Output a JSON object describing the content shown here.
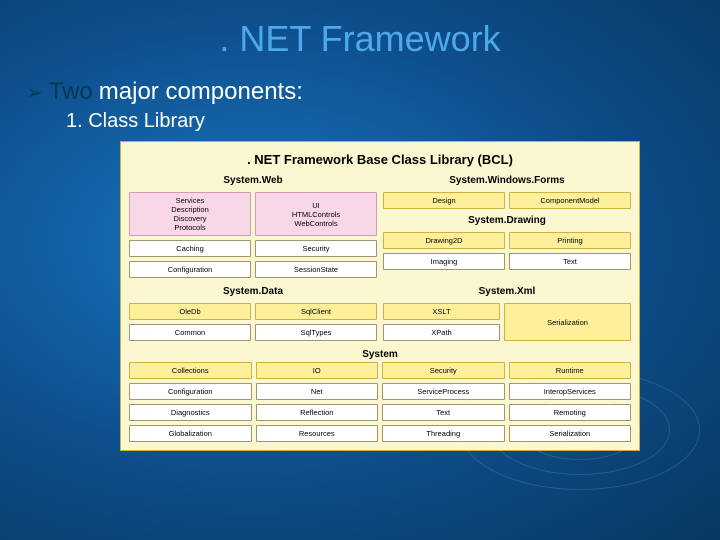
{
  "title": ". NET Framework",
  "bullet": {
    "arrow": "➢",
    "lead": "Two",
    "rest": " major components:"
  },
  "sub": "1. Class Library",
  "diagram": {
    "title": ". NET Framework Base Class Library (BCL)",
    "web": {
      "title": "System.Web",
      "row1": [
        {
          "lines": [
            "Services",
            "Description",
            "Discovery",
            "Protocols"
          ]
        },
        {
          "lines": [
            "UI",
            "HTMLControls",
            "WebControls"
          ]
        }
      ],
      "row2": [
        "Caching",
        "Security"
      ],
      "row3": [
        "Configuration",
        "SessionState"
      ]
    },
    "forms": {
      "title": "System.Windows.Forms",
      "row1": [
        "Design",
        "ComponentModel"
      ]
    },
    "drawing": {
      "title": "System.Drawing",
      "row1": [
        "Drawing2D",
        "Printing"
      ],
      "row2": [
        "Imaging",
        "Text"
      ]
    },
    "data": {
      "title": "System.Data",
      "row1": [
        "OleDb",
        "SqlClient"
      ],
      "row2": [
        "Common",
        "SqlTypes"
      ]
    },
    "xml": {
      "title": "System.Xml",
      "side": "Serialization",
      "col": [
        "XSLT",
        "XPath"
      ]
    },
    "system": {
      "title": "System",
      "row1": [
        "Collections",
        "IO",
        "Security",
        "Runtime"
      ],
      "row2": [
        "Configuration",
        "Net",
        "ServiceProcess",
        "InteropServices"
      ],
      "row3": [
        "Diagnostics",
        "Reflection",
        "Text",
        "Remoting"
      ],
      "row4": [
        "Globalization",
        "Resources",
        "Threading",
        "Serialization"
      ]
    }
  }
}
